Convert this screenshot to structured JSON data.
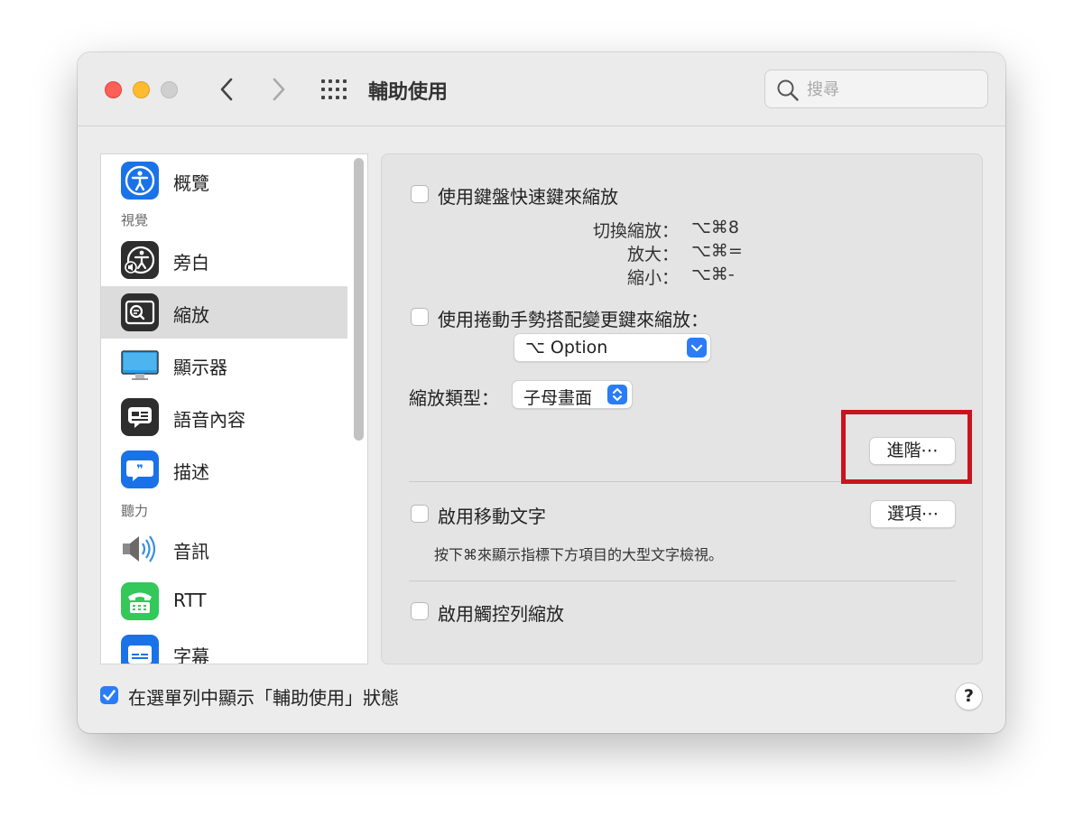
{
  "window": {
    "title": "輔助使用",
    "search_placeholder": "搜尋"
  },
  "sidebar": {
    "items": [
      {
        "label": "概覽",
        "icon": "accessibility-icon"
      },
      {
        "label": "旁白",
        "icon": "voiceover-icon"
      },
      {
        "label": "縮放",
        "icon": "zoom-icon",
        "selected": true
      },
      {
        "label": "顯示器",
        "icon": "display-icon"
      },
      {
        "label": "語音內容",
        "icon": "spoken-content-icon"
      },
      {
        "label": "描述",
        "icon": "descriptions-icon"
      },
      {
        "label": "音訊",
        "icon": "audio-icon"
      },
      {
        "label": "RTT",
        "icon": "rtt-icon"
      },
      {
        "label": "字幕",
        "icon": "captions-icon"
      }
    ],
    "sections": {
      "vision": "視覺",
      "hearing": "聽力"
    }
  },
  "zoom": {
    "keyboard_shortcuts_label": "使用鍵盤快速鍵來縮放",
    "shortcuts": [
      {
        "name": "切換縮放：",
        "keys": "⌥⌘8"
      },
      {
        "name": "放大：",
        "keys": "⌥⌘="
      },
      {
        "name": "縮小：",
        "keys": "⌥⌘-"
      }
    ],
    "scroll_gesture_label": "使用捲動手勢搭配變更鍵來縮放：",
    "modifier_value": "⌥ Option",
    "zoom_style_label": "縮放類型：",
    "zoom_style_value": "子母畫面",
    "advanced_button": "進階⋯",
    "hover_text_label": "啟用移動文字",
    "options_button": "選項⋯",
    "hover_text_hint": "按下⌘來顯示指標下方項目的大型文字檢視。",
    "touch_bar_label": "啟用觸控列縮放"
  },
  "footer": {
    "show_status_label": "在選單列中顯示「輔助使用」狀態",
    "show_status_checked": true,
    "help_label": "?"
  },
  "colors": {
    "accent": "#2a7df6",
    "highlight": "#c8141e"
  }
}
